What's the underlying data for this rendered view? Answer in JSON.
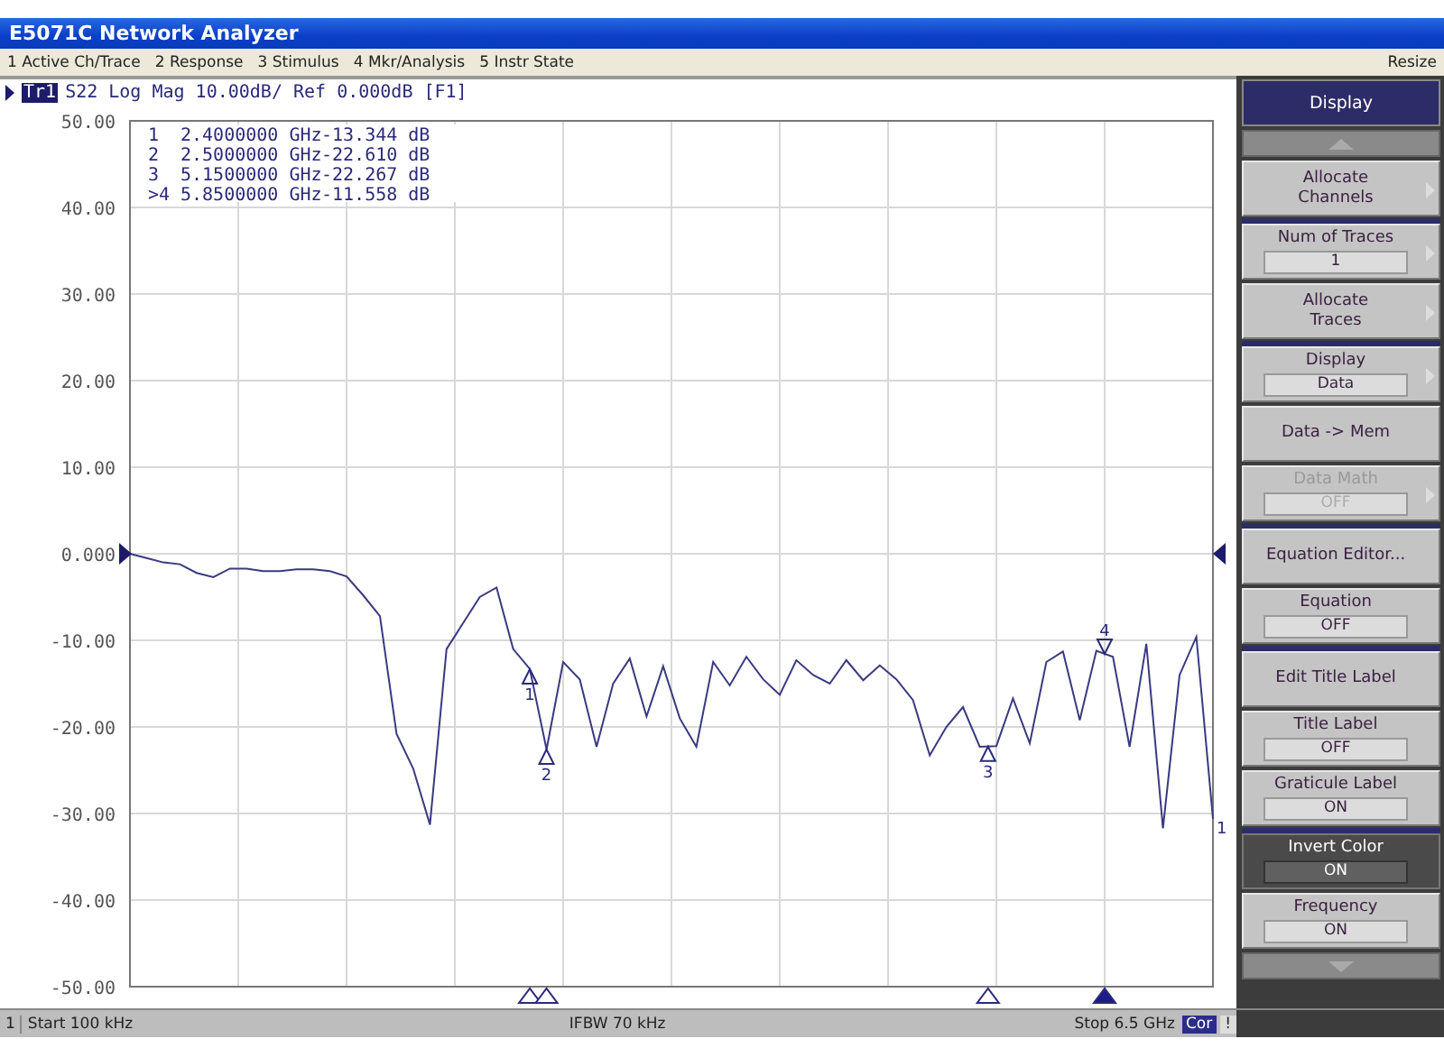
{
  "window": {
    "title": "E5071C Network Analyzer"
  },
  "menu": {
    "items": [
      "1 Active Ch/Trace",
      "2 Response",
      "3 Stimulus",
      "4 Mkr/Analysis",
      "5 Instr State"
    ],
    "right": "Resize"
  },
  "trace_header": {
    "trace": "Tr1",
    "text": "S22 Log Mag 10.00dB/ Ref 0.000dB [F1]"
  },
  "markers": [
    {
      "label": "1",
      "frequency": "2.4000000 GHz",
      "value": "-13.344 dB",
      "active": false
    },
    {
      "label": "2",
      "frequency": "2.5000000 GHz",
      "value": "-22.610 dB",
      "active": false
    },
    {
      "label": "3",
      "frequency": "5.1500000 GHz",
      "value": "-22.267 dB",
      "active": false
    },
    {
      "label": ">4",
      "frequency": "5.8500000 GHz",
      "value": "-11.558 dB",
      "active": true
    }
  ],
  "chart_data": {
    "type": "line",
    "ylim": [
      -50,
      50
    ],
    "yticks": [
      {
        "value": 50,
        "label": "50.00"
      },
      {
        "value": 40,
        "label": "40.00"
      },
      {
        "value": 30,
        "label": "30.00"
      },
      {
        "value": 20,
        "label": "20.00"
      },
      {
        "value": 10,
        "label": "10.00"
      },
      {
        "value": 0,
        "label": "0.000"
      },
      {
        "value": -10,
        "label": "-10.00"
      },
      {
        "value": -20,
        "label": "-20.00"
      },
      {
        "value": -30,
        "label": "-30.00"
      },
      {
        "value": -40,
        "label": "-40.00"
      },
      {
        "value": -50,
        "label": "-50.00"
      }
    ],
    "categories": [
      null,
      null,
      null,
      null,
      null,
      null,
      null,
      null,
      null,
      null,
      null,
      null,
      null,
      null,
      null,
      null,
      null,
      null,
      null,
      null,
      null,
      null,
      null,
      null,
      null,
      null,
      null,
      null,
      null,
      null,
      null,
      null,
      null,
      null,
      null,
      null,
      null,
      null,
      null,
      null,
      null,
      null,
      null,
      null,
      null,
      null,
      null,
      null,
      null,
      null,
      null,
      null,
      null,
      null,
      null,
      null,
      null,
      null,
      null,
      null,
      null,
      null,
      null,
      null,
      null,
      null
    ],
    "series": [
      {
        "color": "#3a3a80",
        "values": [
          0,
          -0.5,
          -1,
          -1.2,
          -2.2,
          -2.7,
          -1.7,
          -1.7,
          -2,
          -2,
          -1.8,
          -1.8,
          -2,
          -2.6,
          -4.8,
          -7.2,
          -20.8,
          -24.8,
          -31.3,
          -11,
          -8,
          -5,
          -3.9,
          -11,
          -13.3,
          -22.6,
          -12.5,
          -14.5,
          -22.3,
          -15,
          -12.1,
          -18.8,
          -13,
          -19,
          -22.3,
          -12.5,
          -15.2,
          -11.9,
          -14.5,
          -16.3,
          -12.3,
          -14,
          -15,
          -12.3,
          -14.6,
          -12.9,
          -14.5,
          -16.9,
          -23.3,
          -20,
          -17.7,
          -22.3,
          -22.2,
          -16.7,
          -21.9,
          -12.5,
          -11.3,
          -19.2,
          -11.2,
          -11.9,
          -22.3,
          -10.4,
          -31.7,
          -14,
          -9.6,
          -30.6
        ]
      }
    ],
    "grid": true,
    "annotations": [
      {
        "y": -13.344,
        "text": "1"
      },
      {
        "y": -22.61,
        "text": "2"
      },
      {
        "y": -22.267,
        "text": "3"
      },
      {
        "y": -11.558,
        "text": "4"
      }
    ]
  },
  "trace_end_label": "1",
  "softkeys": {
    "title": "Display",
    "keys": [
      {
        "kind": "plain",
        "label": "Allocate\nChannels",
        "submenu": true,
        "separator_above": false,
        "disabled": false,
        "highlighted": false
      },
      {
        "kind": "value",
        "label": "Num of Traces",
        "value": "1",
        "submenu": true,
        "separator_above": true,
        "disabled": false,
        "highlighted": false
      },
      {
        "kind": "plain",
        "label": "Allocate\nTraces",
        "submenu": true,
        "separator_above": false,
        "disabled": false,
        "highlighted": false
      },
      {
        "kind": "value",
        "label": "Display",
        "value": "Data",
        "submenu": true,
        "separator_above": true,
        "disabled": false,
        "highlighted": false
      },
      {
        "kind": "plain",
        "label": "Data -> Mem",
        "submenu": false,
        "separator_above": false,
        "disabled": false,
        "highlighted": false
      },
      {
        "kind": "value",
        "label": "Data Math",
        "value": "OFF",
        "submenu": true,
        "separator_above": false,
        "disabled": true,
        "highlighted": false
      },
      {
        "kind": "plain",
        "label": "Equation Editor...",
        "submenu": false,
        "separator_above": true,
        "disabled": false,
        "highlighted": false
      },
      {
        "kind": "value",
        "label": "Equation",
        "value": "OFF",
        "submenu": false,
        "separator_above": false,
        "disabled": false,
        "highlighted": false
      },
      {
        "kind": "plain",
        "label": "Edit Title Label",
        "submenu": false,
        "separator_above": true,
        "disabled": false,
        "highlighted": false
      },
      {
        "kind": "value",
        "label": "Title Label",
        "value": "OFF",
        "submenu": false,
        "separator_above": false,
        "disabled": false,
        "highlighted": false
      },
      {
        "kind": "value",
        "label": "Graticule Label",
        "value": "ON",
        "submenu": false,
        "separator_above": false,
        "disabled": false,
        "highlighted": false
      },
      {
        "kind": "value",
        "label": "Invert Color",
        "value": "ON",
        "submenu": false,
        "separator_above": true,
        "disabled": false,
        "highlighted": true
      },
      {
        "kind": "value",
        "label": "Frequency",
        "value": "ON",
        "submenu": false,
        "separator_above": false,
        "disabled": false,
        "highlighted": false
      }
    ]
  },
  "status_bar": {
    "channel": "1",
    "start": "Start 100 kHz",
    "ifbw": "IFBW 70 kHz",
    "stop": "Stop 6.5 GHz",
    "correction": "Cor",
    "warning": "!"
  }
}
